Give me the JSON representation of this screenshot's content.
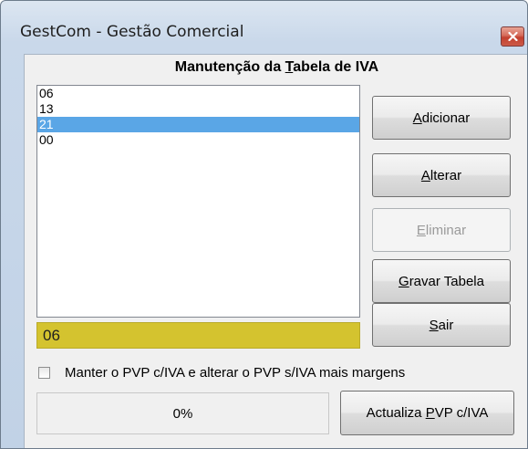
{
  "window": {
    "title": "GestCom - Gestão Comercial"
  },
  "heading": {
    "part1": "Manutenção da ",
    "accel": "T",
    "part2": "abela de IVA"
  },
  "list": {
    "items": [
      "06",
      "13",
      "21",
      "00"
    ],
    "selected_index": 2
  },
  "current_value": "06",
  "buttons": {
    "add": {
      "accel": "A",
      "rest": "dicionar"
    },
    "edit": {
      "pre": "",
      "accel": "A",
      "rest": "lterar"
    },
    "delete": {
      "accel": "E",
      "rest": "liminar",
      "enabled": false
    },
    "save": {
      "accel": "G",
      "rest": "ravar Tabela"
    },
    "exit": {
      "accel": "S",
      "rest": "air"
    },
    "update": {
      "pre": "Actualiza ",
      "accel": "P",
      "rest": "VP c/IVA"
    }
  },
  "checkbox": {
    "label": "Manter o PVP c/IVA e alterar o PVP s/IVA mais margens",
    "checked": false
  },
  "progress": {
    "text": "0%",
    "value": 0
  },
  "colors": {
    "selection": "#5aa6e6",
    "value_display": "#d4c32f",
    "close_button": "#c2402f"
  },
  "icons": {
    "close": "close-icon"
  }
}
